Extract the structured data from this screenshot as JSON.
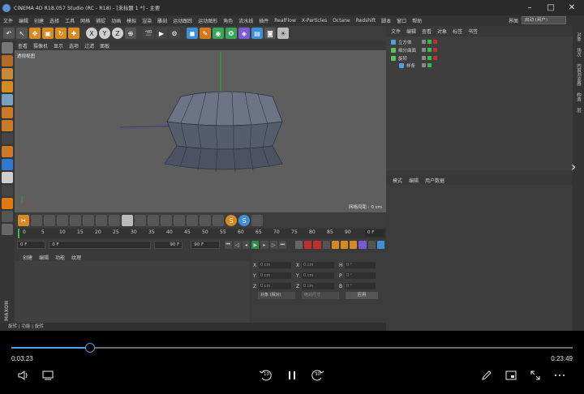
{
  "window": {
    "title": "CINEMA 4D R18.057 Studio (RC - R18) - [未标题 1 *] - 主要"
  },
  "menubar": {
    "items": [
      "文件",
      "编辑",
      "创建",
      "选择",
      "工具",
      "网格",
      "捕捉",
      "动画",
      "模拟",
      "渲染",
      "雕刻",
      "运动跟踪",
      "运动图形",
      "角色",
      "流水线",
      "插件",
      "RealFlow",
      "X-Particles",
      "Octane",
      "Redshift",
      "脚本",
      "窗口",
      "帮助"
    ],
    "interface_label": "界面",
    "interface_value": "启动 (用户)"
  },
  "viewport": {
    "menu": [
      "查看",
      "摄像机",
      "显示",
      "选项",
      "过滤",
      "面板"
    ],
    "label": "透视视图",
    "grid_distance": "网格间距 : 0 cm"
  },
  "timeline": {
    "ticks": [
      "0",
      "5",
      "10",
      "15",
      "20",
      "25",
      "30",
      "35",
      "40",
      "45",
      "50",
      "55",
      "60",
      "65",
      "70",
      "75",
      "80",
      "85",
      "90"
    ],
    "current_frame": "0 F",
    "start_field": "0 F",
    "min_field": "0 F",
    "max_field": "90 F",
    "end_field": "90 F"
  },
  "materials": {
    "menu": [
      "创建",
      "编辑",
      "功能",
      "纹理"
    ]
  },
  "coordinates": {
    "rows": [
      {
        "a": "X",
        "v1": "0 cm",
        "b": "X",
        "v2": "0 cm",
        "c": "H",
        "v3": "0 °"
      },
      {
        "a": "Y",
        "v1": "0 cm",
        "b": "Y",
        "v2": "0 cm",
        "c": "P",
        "v3": "0 °"
      },
      {
        "a": "Z",
        "v1": "0 cm",
        "b": "Z",
        "v2": "0 cm",
        "c": "B",
        "v3": "0 °"
      }
    ],
    "mode": "对象 (相对)",
    "size_mode": "绝对尺寸",
    "apply": "应用"
  },
  "object_manager": {
    "menu": [
      "文件",
      "编辑",
      "查看",
      "对象",
      "标签",
      "书签"
    ],
    "objects": [
      {
        "name": "立方体",
        "color": "#4fa0e0",
        "indent": 0
      },
      {
        "name": "细分曲面",
        "color": "#5cc05c",
        "indent": 0
      },
      {
        "name": "旋转",
        "color": "#5cc05c",
        "indent": 0
      },
      {
        "name": "样条",
        "color": "#4fa0e0",
        "indent": 1
      }
    ]
  },
  "attribute_manager": {
    "menu": [
      "模式",
      "编辑",
      "用户数据"
    ]
  },
  "right_tabs": [
    "对象",
    "场次",
    "内容浏览器",
    "构造",
    "层"
  ],
  "statusbar": {
    "text": "旋转 | 功能 | 旋转"
  },
  "brand": {
    "text": "MAXON"
  },
  "player": {
    "elapsed": "0:03:23",
    "total": "0:23:49",
    "progress": 0.14,
    "skip_back": "10",
    "skip_forward": "30",
    "accent": "#4aa6e8"
  }
}
